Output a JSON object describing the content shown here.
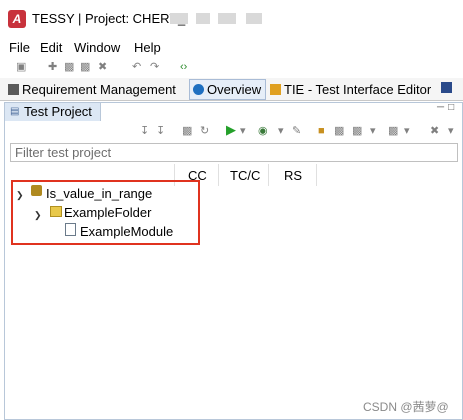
{
  "window": {
    "title": "TESSY | Project: CHERY_"
  },
  "menu": [
    "File",
    "Edit",
    "Window",
    "Help"
  ],
  "perspective_tabs": [
    {
      "label": "Requirement Management"
    },
    {
      "label": "Overview",
      "active": true
    },
    {
      "label": "TIE - Test Interface Editor"
    }
  ],
  "view": {
    "tab_label": "Test Project",
    "filter_placeholder": "Filter test project",
    "columns": [
      "CC",
      "TC/C",
      "RS"
    ]
  },
  "tree": {
    "project": "Is_value_in_range",
    "folder": "ExampleFolder",
    "module": "ExampleModule"
  },
  "watermark": "CSDN @茜萝@",
  "colors": {
    "highlight": "#e0331f",
    "accent": "#c8323c"
  }
}
